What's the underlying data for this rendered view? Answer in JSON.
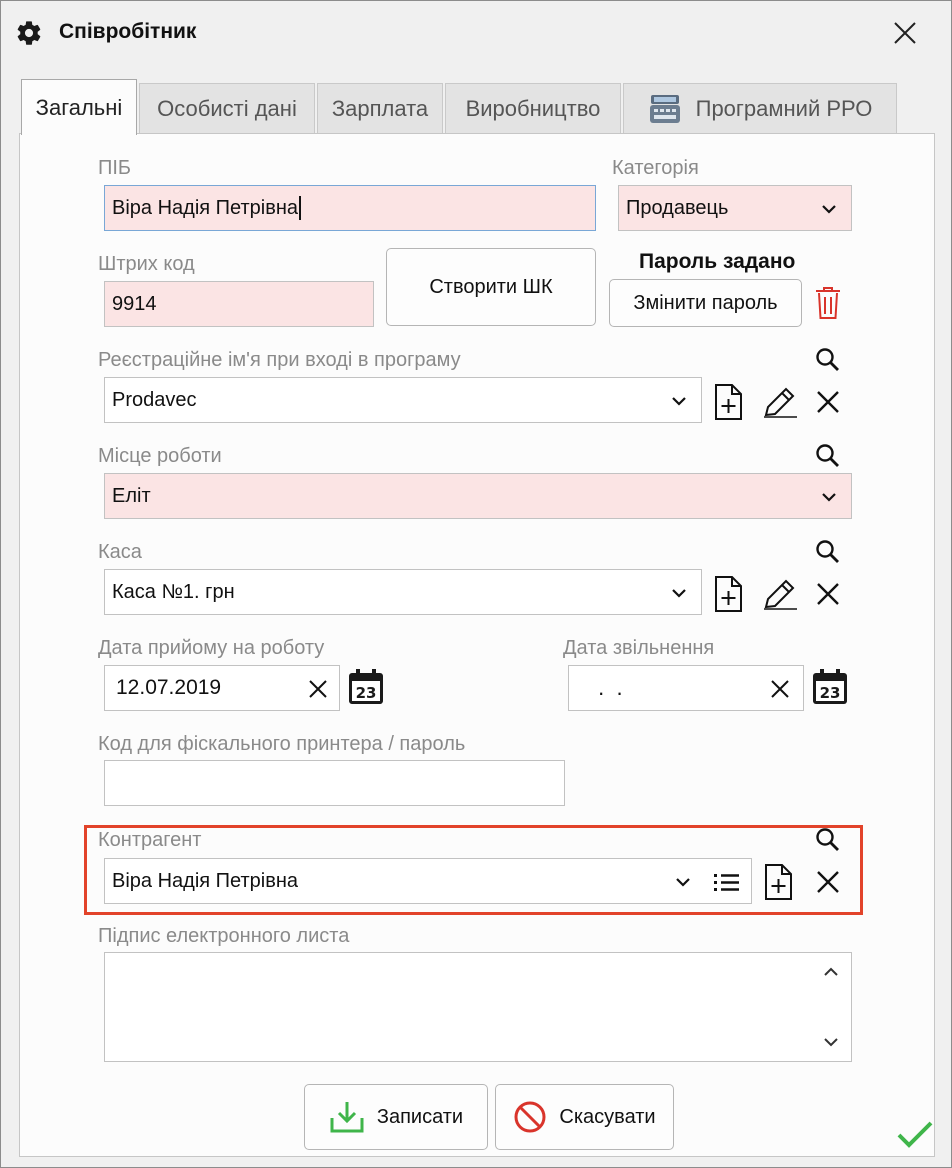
{
  "window": {
    "title": "Співробітник"
  },
  "tabs": [
    {
      "label": "Загальні"
    },
    {
      "label": "Особисті дані"
    },
    {
      "label": "Зарплата"
    },
    {
      "label": "Виробництво"
    },
    {
      "label": "Програмний РРО"
    }
  ],
  "form": {
    "pib": {
      "label": "ПІБ",
      "value": "Віра Надія Петрівна"
    },
    "category": {
      "label": "Категорія",
      "value": "Продавець"
    },
    "barcode": {
      "label": "Штрих код",
      "value": "9914"
    },
    "create_barcode_button": "Створити ШК",
    "password_status": "Пароль задано",
    "change_password_button": "Змінити пароль",
    "login_name": {
      "label": "Реєстраційне ім'я при вході в програму",
      "value": "Prodavec"
    },
    "workplace": {
      "label": "Місце роботи",
      "value": "Еліт"
    },
    "cash": {
      "label": "Каса",
      "value": "Каса №1. грн"
    },
    "hire_date": {
      "label": "Дата прийому на роботу",
      "value": "12.07.2019"
    },
    "dismiss_date": {
      "label": "Дата звільнення",
      "value": " .  . "
    },
    "fiscal_code": {
      "label": "Код для фіскального принтера / пароль",
      "value": ""
    },
    "counterparty": {
      "label": "Контрагент",
      "value": "Віра Надія Петрівна"
    },
    "email_signature": {
      "label": "Підпис електронного листа",
      "value": ""
    },
    "calendar_day": "23"
  },
  "footer": {
    "save_button": "Записати",
    "cancel_button": "Скасувати"
  },
  "colors": {
    "required_bg": "#fbe4e4",
    "highlight_border": "#e2432a",
    "delete_red": "#d9342b",
    "save_green": "#3fb54a",
    "cancel_red": "#d9342b"
  }
}
